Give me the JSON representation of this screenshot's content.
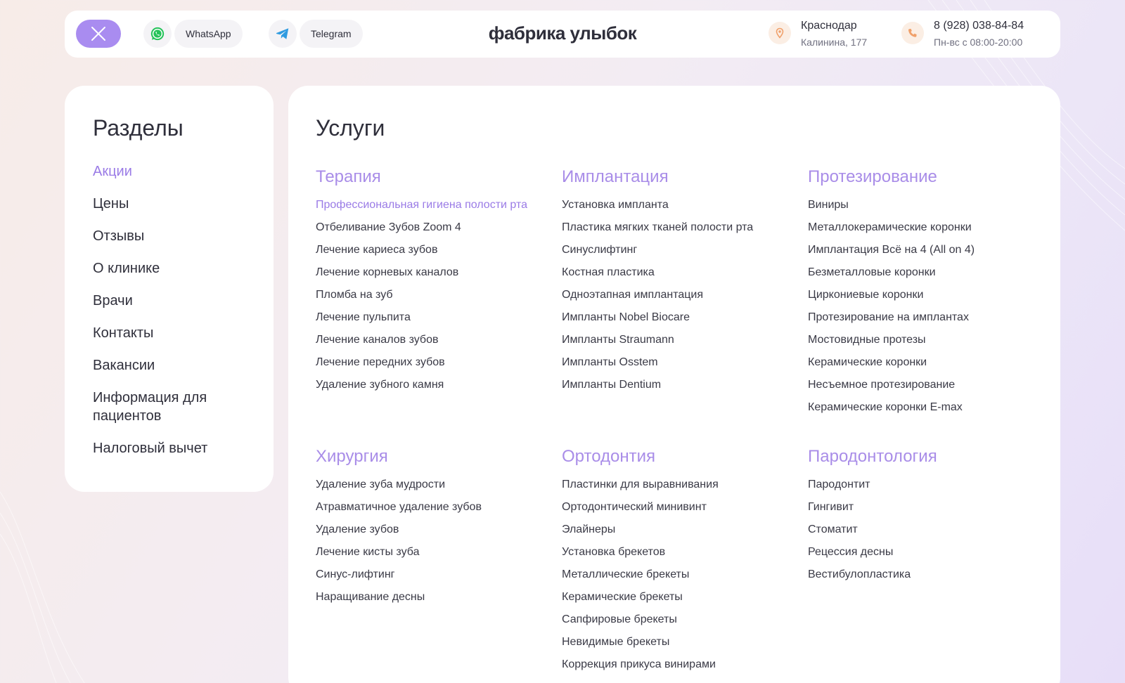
{
  "header": {
    "whatsapp_label": "WhatsApp",
    "telegram_label": "Telegram",
    "logo": "фабрика улыбок",
    "city": "Краснодар",
    "address": "Калинина, 177",
    "phone": "8 (928) 038-84-84",
    "hours": "Пн-вс с 08:00-20:00"
  },
  "sidebar": {
    "title": "Разделы",
    "items": [
      {
        "label": "Акции"
      },
      {
        "label": "Цены"
      },
      {
        "label": "Отзывы"
      },
      {
        "label": "О клинике"
      },
      {
        "label": "Врачи"
      },
      {
        "label": "Контакты"
      },
      {
        "label": "Вакансии"
      },
      {
        "label": "Информация для пациентов"
      },
      {
        "label": "Налоговый вычет"
      }
    ]
  },
  "services": {
    "title": "Услуги",
    "categories": [
      {
        "title": "Терапия",
        "items": [
          "Профессиональная гигиена полости рта",
          "Отбеливание Зубов Zoom 4",
          "Лечение кариеса зубов",
          "Лечение корневых каналов",
          "Пломба на зуб",
          "Лечение пульпита",
          "Лечение каналов зубов",
          "Лечение передних зубов",
          "Удаление зубного камня"
        ]
      },
      {
        "title": "Имплантация",
        "items": [
          "Установка импланта",
          "Пластика мягких тканей полости рта",
          "Синуслифтинг",
          "Костная пластика",
          "Одноэтапная имплантация",
          "Импланты Nobel Biocare",
          "Импланты Straumann",
          "Импланты Osstem",
          "Импланты Dentium"
        ]
      },
      {
        "title": "Протезирование",
        "items": [
          "Виниры",
          "Металлокерамические коронки",
          "Имплантация Всё на 4 (All on 4)",
          "Безметалловые коронки",
          "Циркониевые коронки",
          "Протезирование на имплантах",
          "Мостовидные протезы",
          "Керамические коронки",
          "Несъемное протезирование",
          "Керамические коронки E-max"
        ]
      },
      {
        "title": "Хирургия",
        "items": [
          "Удаление зуба мудрости",
          "Атравматичное удаление зубов",
          "Удаление зубов",
          "Лечение кисты зуба",
          "Синус-лифтинг",
          "Наращивание десны"
        ]
      },
      {
        "title": "Ортодонтия",
        "items": [
          "Пластинки для выравнивания",
          "Ортодонтический минивинт",
          "Элайнеры",
          "Установка брекетов",
          "Металлические брекеты",
          "Керамические брекеты",
          "Сапфировые брекеты",
          "Невидимые брекеты",
          "Коррекция прикуса винирами"
        ]
      },
      {
        "title": "Пародонтология",
        "items": [
          "Пародонтит",
          "Гингивит",
          "Стоматит",
          "Рецессия десны",
          "Вестибулопластика"
        ]
      }
    ]
  },
  "colors": {
    "accent": "#a98cf0",
    "accent_text": "#9a7be6",
    "category_title": "#a98de8",
    "text": "#2f2f3b",
    "contact_icon_bg": "#fbeee4",
    "contact_icon": "#f0a06a",
    "whatsapp": "#25c35a",
    "telegram": "#2f9be0"
  },
  "icons": {
    "close": "close-icon",
    "whatsapp": "whatsapp-icon",
    "telegram": "telegram-icon",
    "location": "location-pin-icon",
    "phone": "phone-icon"
  }
}
